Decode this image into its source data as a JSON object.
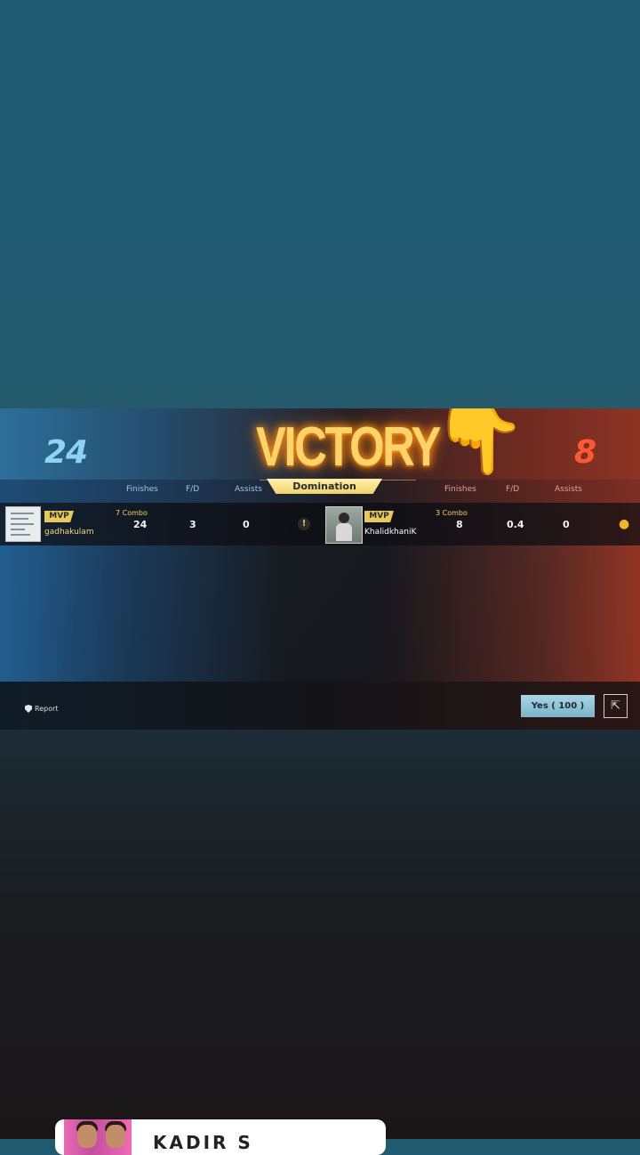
{
  "result": {
    "title": "VICTORY",
    "mode": "Domination",
    "score_left": "24",
    "score_right": "8"
  },
  "headers": {
    "left": [
      "Finishes",
      "F/D",
      "Assists"
    ],
    "right": [
      "Finishes",
      "F/D",
      "Assists"
    ]
  },
  "player_left": {
    "badge": "MVP",
    "name": "gadhakulam",
    "combo": "7 Combo",
    "finishes": "24",
    "fd": "3",
    "assists": "0"
  },
  "player_right": {
    "badge": "MVP",
    "name": "KhalidkhaniK",
    "combo": "3 Combo",
    "finishes": "8",
    "fd": "0.4",
    "assists": "0"
  },
  "footer": {
    "report_label": "Report",
    "yes_label": "Yes ( 100 )"
  },
  "overlay": {
    "hand_emoji": "👇"
  },
  "card": {
    "text": "KADIR S"
  },
  "colors": {
    "victory": "#ffd36a",
    "left_team": "#8cd4f2",
    "right_team": "#ff5a33",
    "button": "#9ccbe0"
  }
}
